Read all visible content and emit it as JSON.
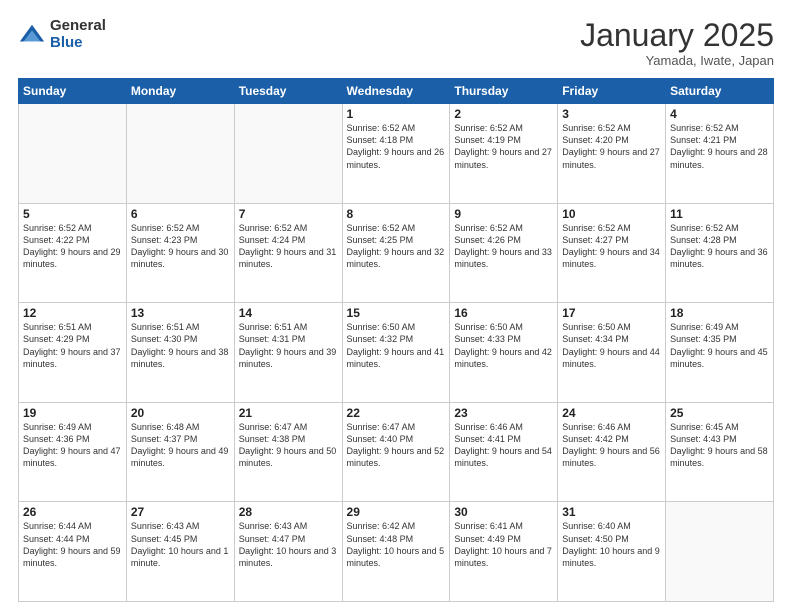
{
  "header": {
    "logo_general": "General",
    "logo_blue": "Blue",
    "month_title": "January 2025",
    "location": "Yamada, Iwate, Japan"
  },
  "days_of_week": [
    "Sunday",
    "Monday",
    "Tuesday",
    "Wednesday",
    "Thursday",
    "Friday",
    "Saturday"
  ],
  "weeks": [
    [
      {
        "day": "",
        "info": ""
      },
      {
        "day": "",
        "info": ""
      },
      {
        "day": "",
        "info": ""
      },
      {
        "day": "1",
        "info": "Sunrise: 6:52 AM\nSunset: 4:18 PM\nDaylight: 9 hours and 26 minutes."
      },
      {
        "day": "2",
        "info": "Sunrise: 6:52 AM\nSunset: 4:19 PM\nDaylight: 9 hours and 27 minutes."
      },
      {
        "day": "3",
        "info": "Sunrise: 6:52 AM\nSunset: 4:20 PM\nDaylight: 9 hours and 27 minutes."
      },
      {
        "day": "4",
        "info": "Sunrise: 6:52 AM\nSunset: 4:21 PM\nDaylight: 9 hours and 28 minutes."
      }
    ],
    [
      {
        "day": "5",
        "info": "Sunrise: 6:52 AM\nSunset: 4:22 PM\nDaylight: 9 hours and 29 minutes."
      },
      {
        "day": "6",
        "info": "Sunrise: 6:52 AM\nSunset: 4:23 PM\nDaylight: 9 hours and 30 minutes."
      },
      {
        "day": "7",
        "info": "Sunrise: 6:52 AM\nSunset: 4:24 PM\nDaylight: 9 hours and 31 minutes."
      },
      {
        "day": "8",
        "info": "Sunrise: 6:52 AM\nSunset: 4:25 PM\nDaylight: 9 hours and 32 minutes."
      },
      {
        "day": "9",
        "info": "Sunrise: 6:52 AM\nSunset: 4:26 PM\nDaylight: 9 hours and 33 minutes."
      },
      {
        "day": "10",
        "info": "Sunrise: 6:52 AM\nSunset: 4:27 PM\nDaylight: 9 hours and 34 minutes."
      },
      {
        "day": "11",
        "info": "Sunrise: 6:52 AM\nSunset: 4:28 PM\nDaylight: 9 hours and 36 minutes."
      }
    ],
    [
      {
        "day": "12",
        "info": "Sunrise: 6:51 AM\nSunset: 4:29 PM\nDaylight: 9 hours and 37 minutes."
      },
      {
        "day": "13",
        "info": "Sunrise: 6:51 AM\nSunset: 4:30 PM\nDaylight: 9 hours and 38 minutes."
      },
      {
        "day": "14",
        "info": "Sunrise: 6:51 AM\nSunset: 4:31 PM\nDaylight: 9 hours and 39 minutes."
      },
      {
        "day": "15",
        "info": "Sunrise: 6:50 AM\nSunset: 4:32 PM\nDaylight: 9 hours and 41 minutes."
      },
      {
        "day": "16",
        "info": "Sunrise: 6:50 AM\nSunset: 4:33 PM\nDaylight: 9 hours and 42 minutes."
      },
      {
        "day": "17",
        "info": "Sunrise: 6:50 AM\nSunset: 4:34 PM\nDaylight: 9 hours and 44 minutes."
      },
      {
        "day": "18",
        "info": "Sunrise: 6:49 AM\nSunset: 4:35 PM\nDaylight: 9 hours and 45 minutes."
      }
    ],
    [
      {
        "day": "19",
        "info": "Sunrise: 6:49 AM\nSunset: 4:36 PM\nDaylight: 9 hours and 47 minutes."
      },
      {
        "day": "20",
        "info": "Sunrise: 6:48 AM\nSunset: 4:37 PM\nDaylight: 9 hours and 49 minutes."
      },
      {
        "day": "21",
        "info": "Sunrise: 6:47 AM\nSunset: 4:38 PM\nDaylight: 9 hours and 50 minutes."
      },
      {
        "day": "22",
        "info": "Sunrise: 6:47 AM\nSunset: 4:40 PM\nDaylight: 9 hours and 52 minutes."
      },
      {
        "day": "23",
        "info": "Sunrise: 6:46 AM\nSunset: 4:41 PM\nDaylight: 9 hours and 54 minutes."
      },
      {
        "day": "24",
        "info": "Sunrise: 6:46 AM\nSunset: 4:42 PM\nDaylight: 9 hours and 56 minutes."
      },
      {
        "day": "25",
        "info": "Sunrise: 6:45 AM\nSunset: 4:43 PM\nDaylight: 9 hours and 58 minutes."
      }
    ],
    [
      {
        "day": "26",
        "info": "Sunrise: 6:44 AM\nSunset: 4:44 PM\nDaylight: 9 hours and 59 minutes."
      },
      {
        "day": "27",
        "info": "Sunrise: 6:43 AM\nSunset: 4:45 PM\nDaylight: 10 hours and 1 minute."
      },
      {
        "day": "28",
        "info": "Sunrise: 6:43 AM\nSunset: 4:47 PM\nDaylight: 10 hours and 3 minutes."
      },
      {
        "day": "29",
        "info": "Sunrise: 6:42 AM\nSunset: 4:48 PM\nDaylight: 10 hours and 5 minutes."
      },
      {
        "day": "30",
        "info": "Sunrise: 6:41 AM\nSunset: 4:49 PM\nDaylight: 10 hours and 7 minutes."
      },
      {
        "day": "31",
        "info": "Sunrise: 6:40 AM\nSunset: 4:50 PM\nDaylight: 10 hours and 9 minutes."
      },
      {
        "day": "",
        "info": ""
      }
    ]
  ]
}
